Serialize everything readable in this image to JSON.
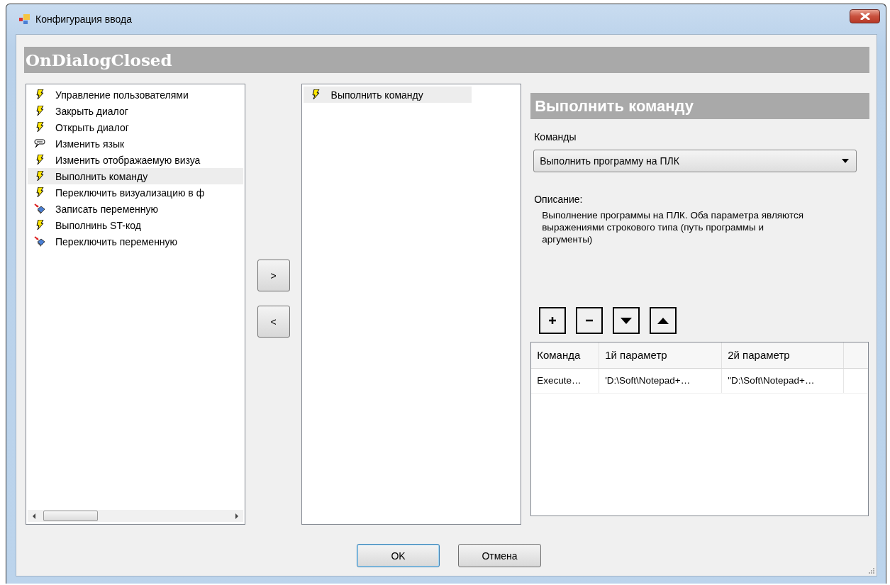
{
  "window": {
    "title": "Конфигурация ввода"
  },
  "event_header": "OnDialogClosed",
  "available_actions": [
    {
      "kind": "event",
      "label": "Управление пользователями",
      "selected": false
    },
    {
      "kind": "event",
      "label": "Закрыть диалог",
      "selected": false
    },
    {
      "kind": "event",
      "label": "Открыть диалог",
      "selected": false
    },
    {
      "kind": "language",
      "label": "Изменить язык",
      "selected": false
    },
    {
      "kind": "event",
      "label": "Изменить отображаемую визуа",
      "selected": false
    },
    {
      "kind": "event",
      "label": "Выполнить команду",
      "selected": true
    },
    {
      "kind": "event",
      "label": "Переключить визуализацию в ф",
      "selected": false
    },
    {
      "kind": "variable",
      "label": "Записать переменную",
      "selected": false
    },
    {
      "kind": "event",
      "label": "Выполнинь ST-код",
      "selected": false
    },
    {
      "kind": "variable",
      "label": "Переключить переменную",
      "selected": false
    }
  ],
  "move_buttons": [
    ">",
    "<"
  ],
  "selected_actions": [
    {
      "kind": "event",
      "label": "Выполнить команду",
      "selected": true
    }
  ],
  "action_panel": {
    "title": "Выполнить команду",
    "commands_label": "Команды",
    "command_dropdown": {
      "value": "Выполнить программу на ПЛК"
    },
    "description_label": "Описание:",
    "description": "Выполнение программы на ПЛК. Оба параметра являются выражениями строкового типа (путь программы и аргументы)",
    "table": {
      "columns": [
        "Команда",
        "1й параметр",
        "2й параметр"
      ],
      "rows": [
        [
          "Execute…",
          "'D:\\Soft\\Notepad+…",
          "\"D:\\Soft\\Notepad+…"
        ]
      ]
    }
  },
  "buttons": [
    {
      "label": "OK",
      "default": true
    },
    {
      "label": "Отмена",
      "default": false
    }
  ]
}
